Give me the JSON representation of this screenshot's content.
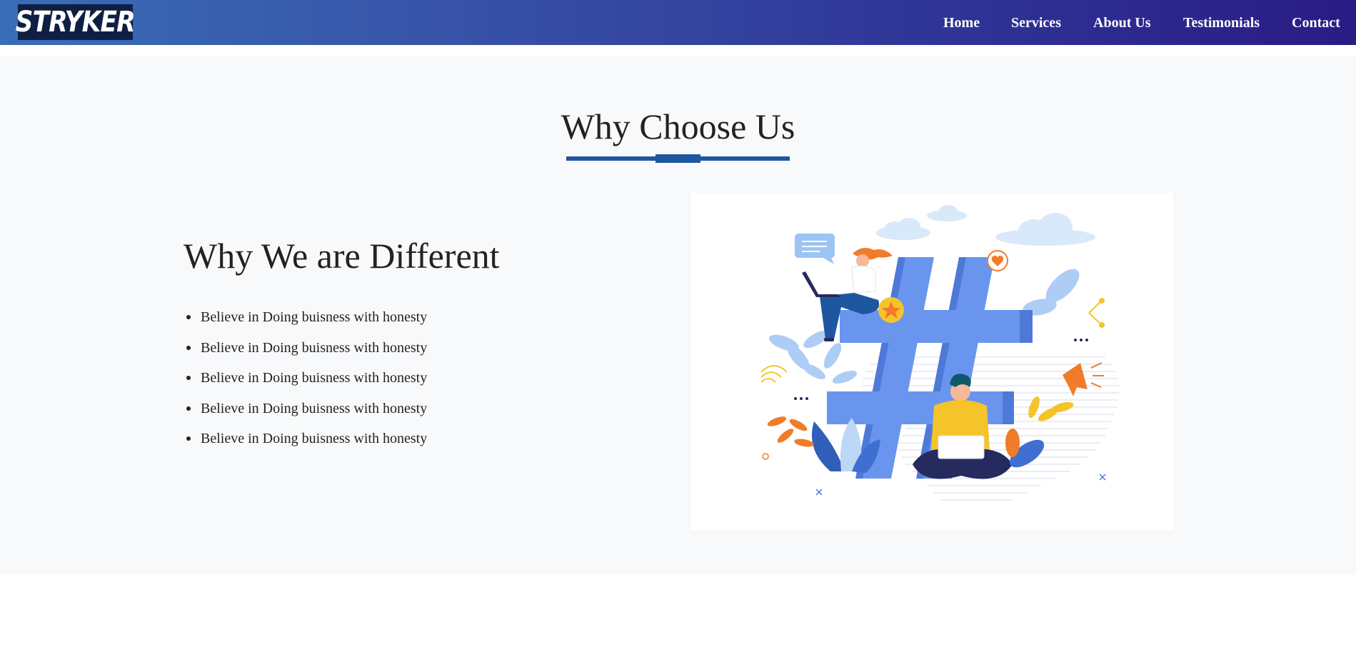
{
  "header": {
    "logo_text": "STRYKER",
    "nav": [
      {
        "label": "Home"
      },
      {
        "label": "Services"
      },
      {
        "label": "About Us"
      },
      {
        "label": "Testimonials"
      },
      {
        "label": "Contact"
      }
    ]
  },
  "why_choose": {
    "title": "Why Choose Us",
    "subtitle": "Why We are Different",
    "features": [
      "Believe in Doing buisness with honesty",
      "Believe in Doing buisness with honesty",
      "Believe in Doing buisness with honesty",
      "Believe in Doing buisness with honesty",
      "Believe in Doing buisness with honesty"
    ],
    "illustration": {
      "subject": "hashtag-people-illustration",
      "colors": {
        "hashtag": "#6a95ee",
        "accent_yellow": "#f5c42b",
        "accent_orange": "#f07c2a",
        "navy": "#252b5e"
      }
    }
  },
  "colors": {
    "nav_gradient_start": "#3a6db6",
    "nav_gradient_end": "#2a1b85",
    "logo_bg": "#0f1f44",
    "accent": "#1e56a0",
    "section_bg": "#f8f9fb"
  }
}
